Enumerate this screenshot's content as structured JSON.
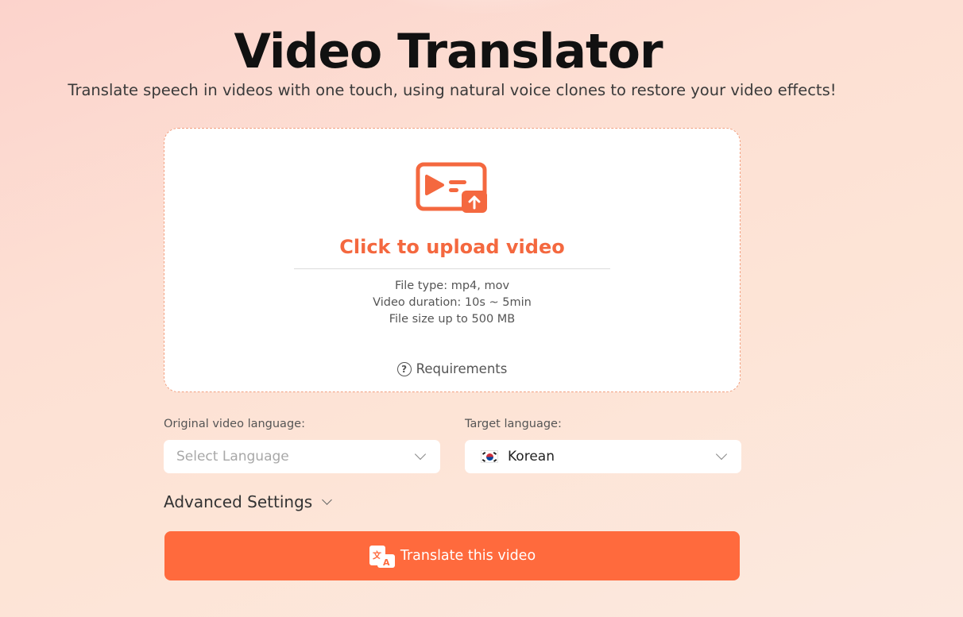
{
  "header": {
    "title": "Video Translator",
    "subtitle": "Translate speech in videos with one touch, using natural voice clones to restore your video effects!"
  },
  "upload": {
    "title": "Click to upload video",
    "file_type": "File type: mp4, mov",
    "duration": "Video duration: 10s ~ 5min",
    "file_size": "File size up to 500 MB",
    "requirements_label": "Requirements",
    "icon": "video-upload-icon"
  },
  "languages": {
    "original_label": "Original video language:",
    "original_placeholder": "Select Language",
    "target_label": "Target language:",
    "target_value": "Korean",
    "target_flag": "south-korea-flag"
  },
  "advanced": {
    "label": "Advanced Settings"
  },
  "action": {
    "translate_label": "Translate this video",
    "icon": "translate-icon"
  },
  "colors": {
    "accent": "#ff6a3d",
    "upload_title": "#f4683f",
    "background_start": "#fcd3cc",
    "background_end": "#fce9df"
  }
}
